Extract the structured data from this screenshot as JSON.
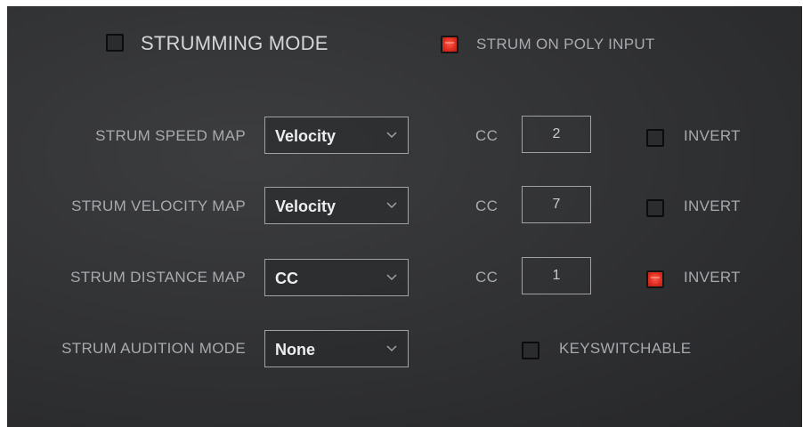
{
  "header": {
    "strumming_mode_label": "STRUMMING MODE",
    "strumming_mode_checked": false,
    "strum_on_poly_label": "STRUM ON POLY INPUT",
    "strum_on_poly_checked": true
  },
  "rows": [
    {
      "label": "STRUM SPEED MAP",
      "select_value": "Velocity",
      "cc_label": "CC",
      "cc_value": "2",
      "invert_label": "INVERT",
      "invert_checked": false
    },
    {
      "label": "STRUM VELOCITY MAP",
      "select_value": "Velocity",
      "cc_label": "CC",
      "cc_value": "7",
      "invert_label": "INVERT",
      "invert_checked": false
    },
    {
      "label": "STRUM DISTANCE MAP",
      "select_value": "CC",
      "cc_label": "CC",
      "cc_value": "1",
      "invert_label": "INVERT",
      "invert_checked": true
    }
  ],
  "audition": {
    "label": "STRUM AUDITION MODE",
    "select_value": "None",
    "keyswitchable_label": "KEYSWITCHABLE",
    "keyswitchable_checked": false
  },
  "colors": {
    "accent_red": "#e02f22",
    "panel_bg": "#323335"
  },
  "icons": {
    "dropdown": "chevron-down-icon"
  }
}
